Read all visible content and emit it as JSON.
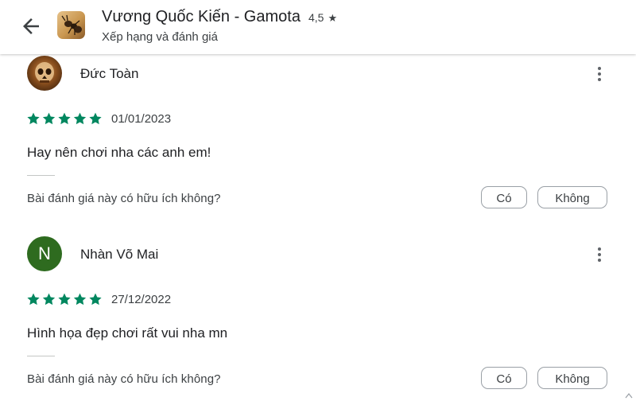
{
  "header": {
    "app_title": "Vương Quốc Kiến - Gamota",
    "rating": "4,5",
    "subtitle": "Xếp hạng và đánh giá"
  },
  "reviews": [
    {
      "author": "Đức Toàn",
      "avatar_type": "photo",
      "stars": 5,
      "date": "01/01/2023",
      "text": "Hay nên chơi nha các anh em!",
      "helpful_question": "Bài đánh giá này có hữu ích không?",
      "yes_label": "Có",
      "no_label": "Không"
    },
    {
      "author": "Nhàn Võ Mai",
      "avatar_letter": "N",
      "avatar_type": "letter",
      "stars": 5,
      "date": "27/12/2022",
      "text": "Hình họa đẹp chơi rất vui nha mn",
      "helpful_question": "Bài đánh giá này có hữu ích không?",
      "yes_label": "Có",
      "no_label": "Không"
    }
  ],
  "colors": {
    "star_green": "#01875f",
    "letter_avatar": "#2e6b1f"
  },
  "icons": [
    "back-arrow-icon",
    "app-icon",
    "star-icon",
    "more-vert-icon",
    "scroll-up-icon"
  ]
}
